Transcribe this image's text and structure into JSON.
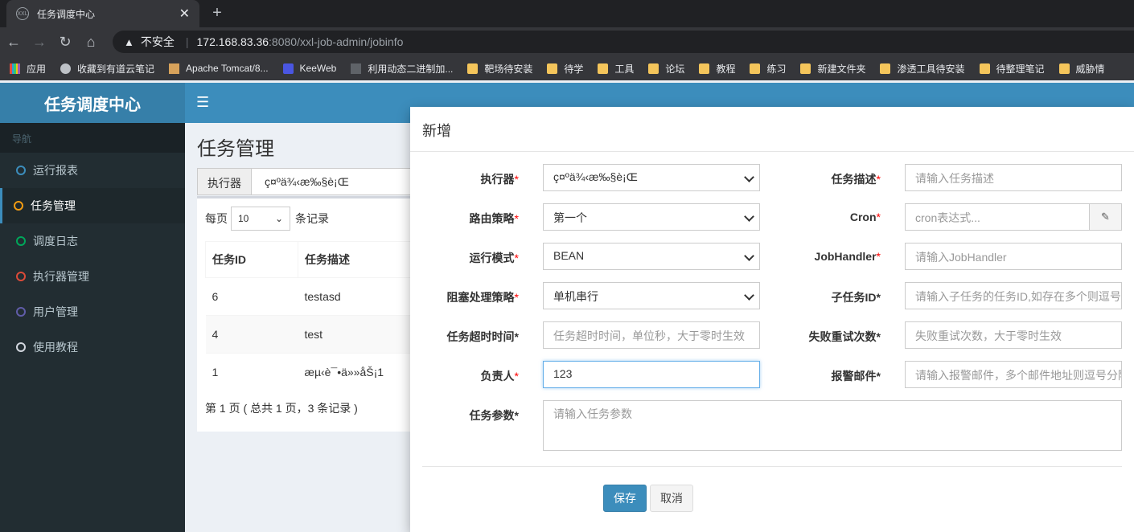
{
  "browser": {
    "tab_title": "任务调度中心",
    "favicon_text": "XXL",
    "close_glyph": "✕",
    "newtab_glyph": "+",
    "insecure_label": "不安全",
    "url_host": "172.168.83.36",
    "url_path": ":8080/xxl-job-admin/jobinfo",
    "bookmarks": [
      {
        "label": "应用",
        "icon": "apps-grid-icon"
      },
      {
        "label": "收藏到有道云笔记",
        "icon": "globe-icon"
      },
      {
        "label": "Apache Tomcat/8...",
        "icon": "tomcat-icon"
      },
      {
        "label": "KeeWeb",
        "icon": "keeweb-icon"
      },
      {
        "label": "利用动态二进制加...",
        "icon": "page-icon"
      },
      {
        "label": "靶场待安装",
        "icon": "folder-icon"
      },
      {
        "label": "待学",
        "icon": "folder-icon"
      },
      {
        "label": "工具",
        "icon": "folder-icon"
      },
      {
        "label": "论坛",
        "icon": "folder-icon"
      },
      {
        "label": "教程",
        "icon": "folder-icon"
      },
      {
        "label": "练习",
        "icon": "folder-icon"
      },
      {
        "label": "新建文件夹",
        "icon": "folder-icon"
      },
      {
        "label": "渗透工具待安装",
        "icon": "folder-icon"
      },
      {
        "label": "待整理笔记",
        "icon": "folder-icon"
      },
      {
        "label": "威胁情",
        "icon": "folder-icon"
      }
    ]
  },
  "sidebar": {
    "logo": "任务调度中心",
    "nav_header": "导航",
    "items": [
      {
        "label": "运行报表",
        "color": "#3c8dbc"
      },
      {
        "label": "任务管理",
        "color": "#f39c12"
      },
      {
        "label": "调度日志",
        "color": "#00a65a"
      },
      {
        "label": "执行器管理",
        "color": "#dd4b39"
      },
      {
        "label": "用户管理",
        "color": "#605ca8"
      },
      {
        "label": "使用教程",
        "color": "#d2d6de"
      }
    ]
  },
  "main": {
    "title": "任务管理",
    "filter_label": "执行器",
    "filter_value": "ç¤ºä¾‹æ‰§è¡Œ",
    "per_page_prefix": "每页",
    "per_page_value": "10",
    "per_page_suffix": "条记录",
    "columns": [
      "任务ID",
      "任务描述"
    ],
    "rows": [
      [
        "6",
        "testasd"
      ],
      [
        "4",
        "test"
      ],
      [
        "1",
        "æµ‹è¯•ä»»åŠ¡1"
      ]
    ],
    "page_info": "第 1 页 ( 总共 1 页，3 条记录 )"
  },
  "modal": {
    "title": "新增",
    "labels": {
      "executor": "执行器",
      "route": "路由策略",
      "run_mode": "运行模式",
      "block": "阻塞处理策略",
      "timeout": "任务超时时间",
      "owner": "负责人",
      "params": "任务参数",
      "desc": "任务描述",
      "cron": "Cron",
      "handler": "JobHandler",
      "child": "子任务ID",
      "retry": "失败重试次数",
      "alarm": "报警邮件"
    },
    "values": {
      "executor": "ç¤ºä¾‹æ‰§è¡Œ",
      "route": "第一个",
      "run_mode": "BEAN",
      "block": "单机串行",
      "owner": "123"
    },
    "placeholders": {
      "timeout": "任务超时时间，单位秒，大于零时生效",
      "params": "请输入任务参数",
      "desc": "请输入任务描述",
      "cron": "cron表达式...",
      "handler": "请输入JobHandler",
      "child": "请输入子任务的任务ID,如存在多个则逗号分隔",
      "retry": "失败重试次数，大于零时生效",
      "alarm": "请输入报警邮件，多个邮件地址则逗号分隔"
    },
    "save_label": "保存",
    "cancel_label": "取消"
  }
}
